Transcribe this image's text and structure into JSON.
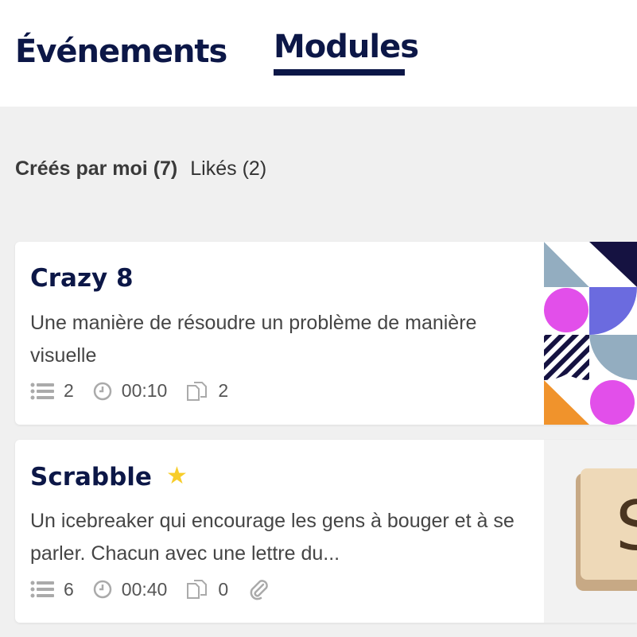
{
  "tabs": [
    {
      "label": "Événements",
      "active": false
    },
    {
      "label": "Modules",
      "active": true
    }
  ],
  "filters": [
    {
      "label": "Créés par moi",
      "count": "(7)",
      "active": true
    },
    {
      "label": "Likés",
      "count": "(2)",
      "active": false
    }
  ],
  "cards": [
    {
      "title": "Crazy 8",
      "description": "Une manière de résoudre un problème de manière visuelle",
      "steps": "2",
      "duration": "00:10",
      "copies": "2",
      "starred": false,
      "has_attachment": false,
      "thumbnail": "geometric-pattern"
    },
    {
      "title": "Scrabble",
      "description": "Un icebreaker qui encourage les gens à bouger et à se parler. Chacun avec une lettre du...",
      "steps": "6",
      "duration": "00:40",
      "copies": "0",
      "starred": true,
      "has_attachment": true,
      "thumbnail": "scrabble-tile",
      "thumbnail_letter": "S"
    }
  ],
  "colors": {
    "navy": "#0c1747",
    "star": "#f7cd2a",
    "background": "#f0f0f0"
  }
}
